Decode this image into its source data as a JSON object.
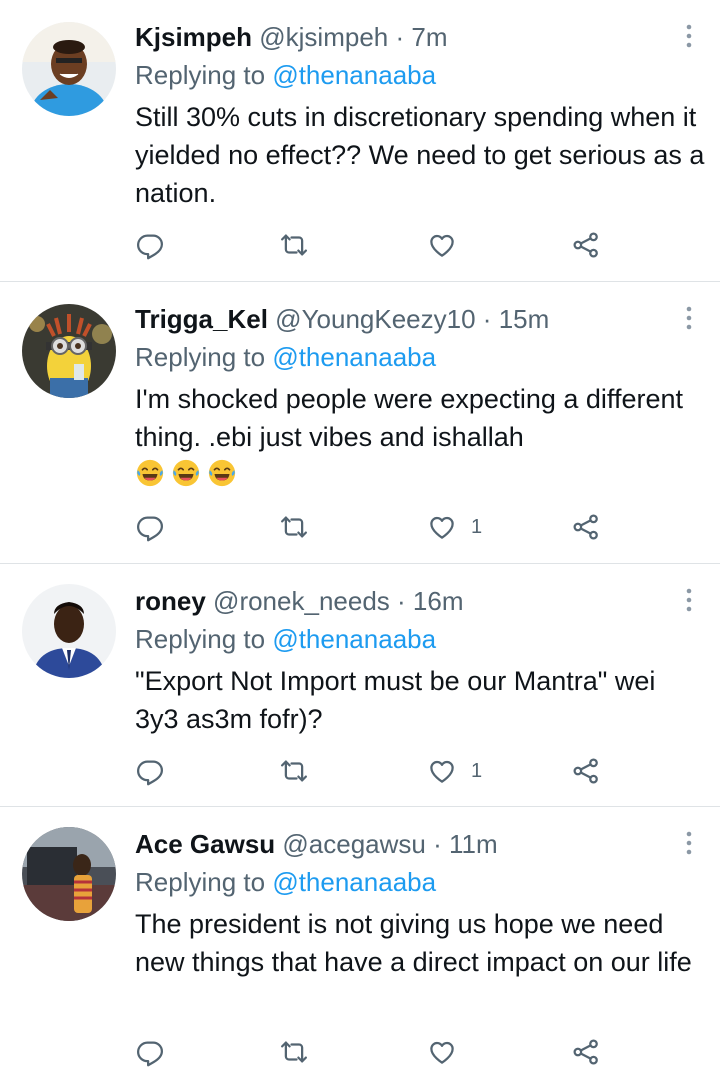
{
  "replying_prefix": "Replying to ",
  "tweets": [
    {
      "name": "Kjsimpeh",
      "handle": "@kjsimpeh",
      "time": "7m",
      "reply_to": "@thenanaaba",
      "text": "Still 30% cuts in discretionary spending when it yielded no effect?? We need to get serious as a nation.",
      "likes": "",
      "avatar": "avatar-man-blue-shirt"
    },
    {
      "name": "Trigga_Kel",
      "handle": "@YoungKeezy10",
      "time": "15m",
      "reply_to": "@thenanaaba",
      "text": "I'm shocked people were expecting a different thing. .ebi just vibes and ishallah",
      "emojis": [
        "face-with-tears-of-joy",
        "face-with-tears-of-joy",
        "face-with-tears-of-joy"
      ],
      "likes": "1",
      "avatar": "avatar-minion"
    },
    {
      "name": "roney",
      "handle": "@ronek_needs",
      "time": "16m",
      "reply_to": "@thenanaaba",
      "text": "\"Export Not Import must be our Mantra\" wei 3y3 as3m fofr)?",
      "likes": "1",
      "avatar": "avatar-man-suit"
    },
    {
      "name": "Ace Gawsu",
      "handle": "@acegawsu",
      "time": "11m",
      "reply_to": "@thenanaaba",
      "text": "The president is not giving us hope we need new things that have a direct impact on our life",
      "likes": "",
      "avatar": "avatar-child-car"
    }
  ],
  "colors": {
    "link": "#1d9bf0",
    "muted": "#536471",
    "text": "#0f1419",
    "divider": "#dfe3e6"
  }
}
